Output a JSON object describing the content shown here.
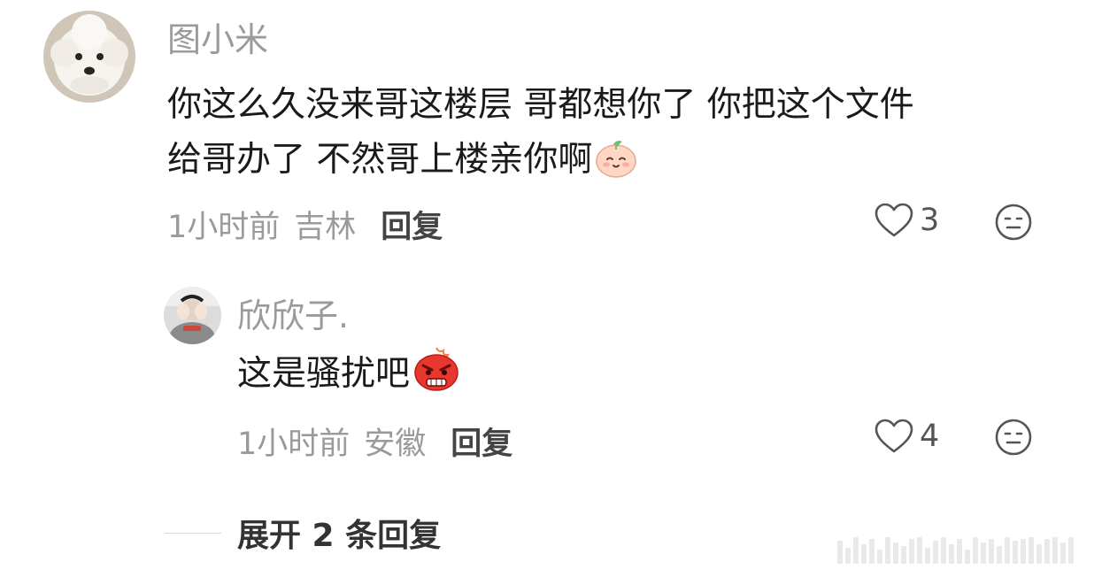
{
  "comment": {
    "username": "图小米",
    "text_line1": "你这么久没来哥这楼层 哥都想你了 你把这个文件",
    "text_line2": "给哥办了 不然哥上楼亲你啊",
    "emoji": "smiling-peach-emoji",
    "time": "1小时前",
    "location": "吉林",
    "reply_label": "回复",
    "like_count": "3",
    "avatar": "white-poodle-avatar"
  },
  "reply": {
    "username": "欣欣子.",
    "text": "这是骚扰吧",
    "emoji": "angry-red-emoji",
    "time": "1小时前",
    "location": "安徽",
    "reply_label": "回复",
    "like_count": "4",
    "avatar": "person-covering-face-avatar"
  },
  "expand": {
    "label": "展开 2 条回复"
  },
  "colors": {
    "username": "#9a9a9a",
    "text": "#1a1a1a",
    "meta": "#9a9a9a",
    "reply_button": "#444444",
    "icon": "#555555"
  }
}
